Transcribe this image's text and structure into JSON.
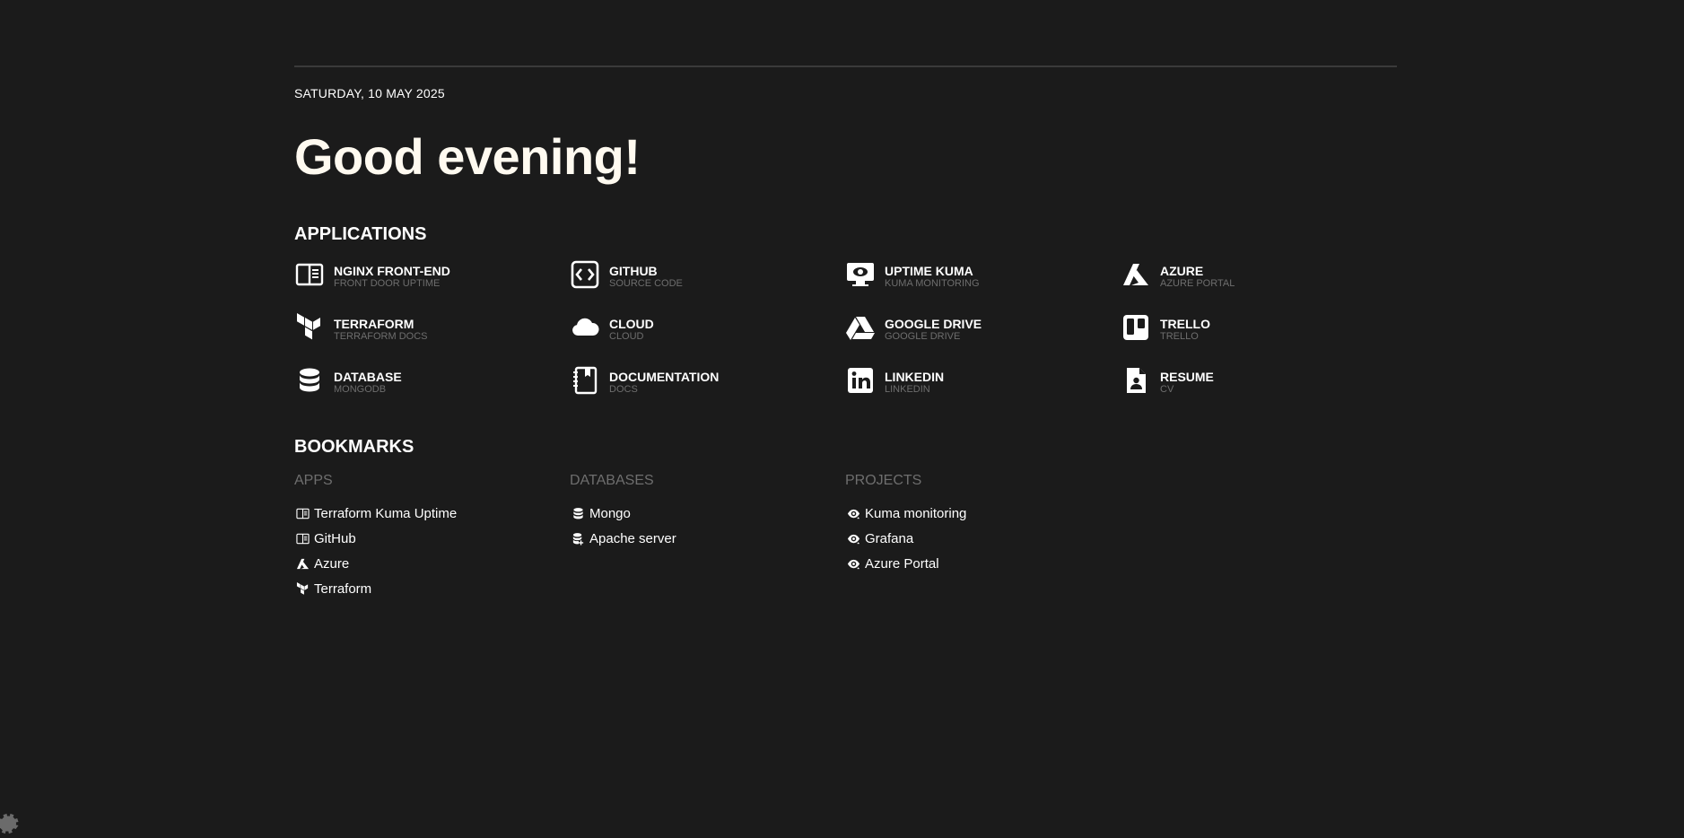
{
  "date": "SATURDAY, 10 MAY 2025",
  "greeting": "Good evening!",
  "applications": {
    "title": "APPLICATIONS",
    "items": [
      {
        "name": "NGINX FRONT-END",
        "desc": "FRONT DOOR UPTIME",
        "icon": "book-open-icon"
      },
      {
        "name": "GITHUB",
        "desc": "SOURCE CODE",
        "icon": "code-icon"
      },
      {
        "name": "UPTIME KUMA",
        "desc": "KUMA MONITORING",
        "icon": "monitor-eye-icon"
      },
      {
        "name": "AZURE",
        "desc": "AZURE PORTAL",
        "icon": "azure-icon"
      },
      {
        "name": "TERRAFORM",
        "desc": "TERRAFORM DOCS",
        "icon": "terraform-icon"
      },
      {
        "name": "CLOUD",
        "desc": "CLOUD",
        "icon": "cloud-icon"
      },
      {
        "name": "GOOGLE DRIVE",
        "desc": "GOOGLE DRIVE",
        "icon": "google-drive-icon"
      },
      {
        "name": "TRELLO",
        "desc": "TRELLO",
        "icon": "trello-icon"
      },
      {
        "name": "DATABASE",
        "desc": "MONGODB",
        "icon": "database-icon"
      },
      {
        "name": "DOCUMENTATION",
        "desc": "DOCS",
        "icon": "notebook-icon"
      },
      {
        "name": "LINKEDIN",
        "desc": "LINKEDIN",
        "icon": "linkedin-icon"
      },
      {
        "name": "RESUME",
        "desc": "CV",
        "icon": "resume-icon"
      }
    ]
  },
  "bookmarks": {
    "title": "BOOKMARKS",
    "columns": [
      {
        "title": "APPS",
        "links": [
          {
            "label": "Terraform Kuma Uptime",
            "icon": "book-open-icon"
          },
          {
            "label": "GitHub",
            "icon": "book-open-icon"
          },
          {
            "label": "Azure",
            "icon": "azure-icon"
          },
          {
            "label": "Terraform",
            "icon": "terraform-icon"
          }
        ]
      },
      {
        "title": "DATABASES",
        "links": [
          {
            "label": "Mongo",
            "icon": "database-icon"
          },
          {
            "label": "Apache server",
            "icon": "database-plus-icon"
          }
        ]
      },
      {
        "title": "PROJECTS",
        "links": [
          {
            "label": "Kuma monitoring",
            "icon": "eye-refresh-icon"
          },
          {
            "label": "Grafana",
            "icon": "eye-refresh-icon"
          },
          {
            "label": "Azure Portal",
            "icon": "eye-refresh-icon"
          }
        ]
      }
    ]
  },
  "colors": {
    "background": "#1b1b1b",
    "foreground": "#ffffff",
    "accent_text": "#fffaf0",
    "muted": "#6e6e6e"
  }
}
